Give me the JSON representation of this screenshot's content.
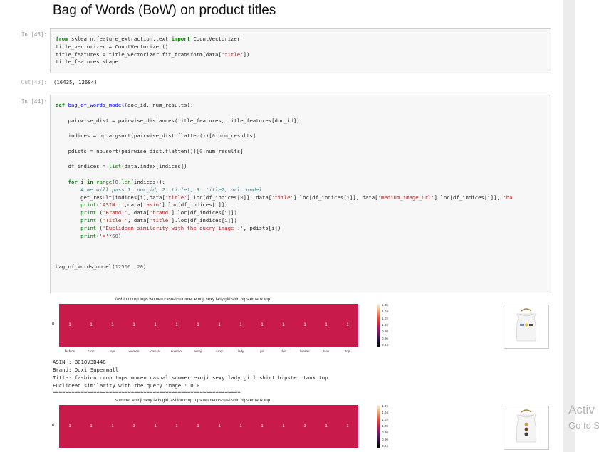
{
  "heading": "Bag of Words (BoW) on product titles",
  "cell43": {
    "in_prompt": "In [43]:",
    "out_prompt": "Out[43]:",
    "output": "(16435, 12684)"
  },
  "cell44": {
    "in_prompt": "In [44]:"
  },
  "results": [
    {
      "heatmap_title": "fashion crop tops women casual summer emoji sexy lady girl shirt hipster tank top",
      "words": [
        "fashion",
        "crop",
        "tops",
        "women",
        "casual",
        "summer",
        "emoji",
        "sexy",
        "lady",
        "girl",
        "shirt",
        "hipster",
        "tank",
        "top"
      ],
      "values": [
        "1",
        "1",
        "1",
        "1",
        "1",
        "1",
        "1",
        "1",
        "1",
        "1",
        "1",
        "1",
        "1",
        "1"
      ],
      "row_label": "0",
      "asin": "ASIN : B010V3B44G",
      "brand": "Brand: Doxi Supermall",
      "title": "Title: fashion crop tops women casual summer emoji sexy lady girl shirt hipster tank top",
      "similarity": "Euclidean similarity with the query image : 0.0",
      "separator": "============================================================"
    },
    {
      "heatmap_title": "summer emoji sexy lady girl fashion crop tops women casual shirt hipster tank top",
      "values": [
        "1",
        "1",
        "1",
        "1",
        "1",
        "1",
        "1",
        "1",
        "1",
        "1",
        "1",
        "1",
        "1",
        "1"
      ],
      "row_label": "0"
    }
  ],
  "colorbar_ticks": [
    "1.06",
    "1.04",
    "1.02",
    "1.00",
    "0.98",
    "0.96",
    "0.94"
  ],
  "watermark": {
    "line1": "Activ",
    "line2": "Go to S"
  },
  "colors": {
    "heat_cell": "#c81a4b",
    "cmap": [
      "#fdf0da",
      "#f8a56c",
      "#e94f35",
      "#c81a4b",
      "#7a1a64",
      "#2f0f3d",
      "#000004"
    ]
  }
}
